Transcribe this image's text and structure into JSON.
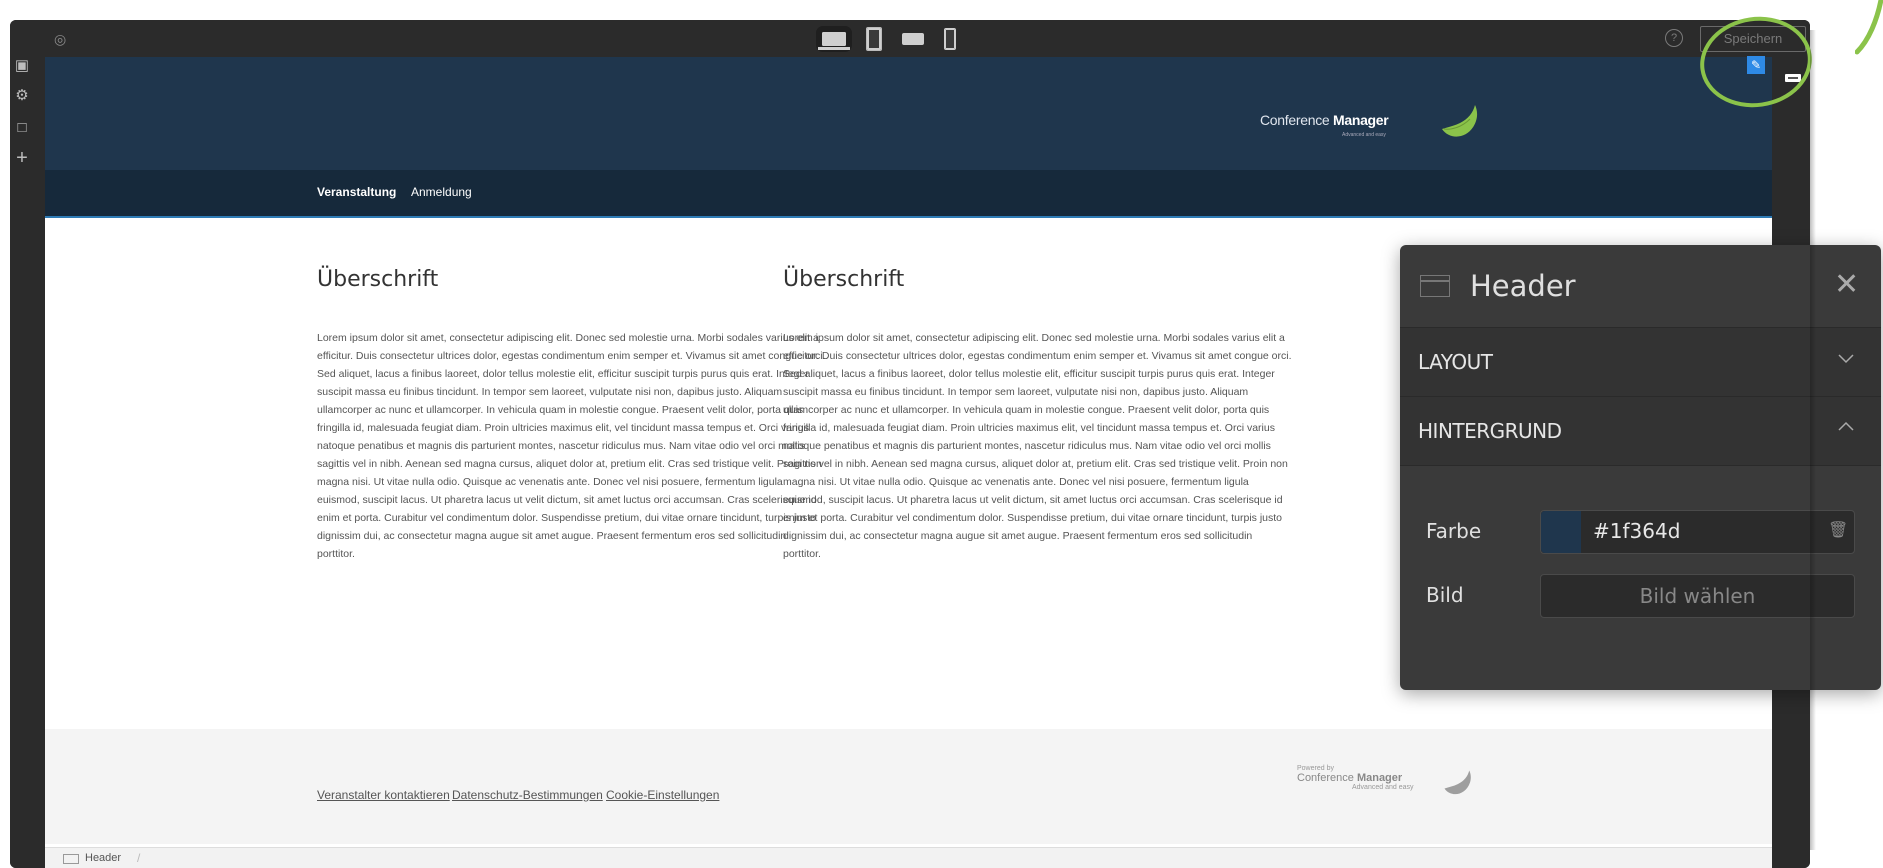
{
  "toolbar": {
    "device_icons": [
      "desktop-icon",
      "tablet-portrait-icon",
      "tablet-landscape-icon",
      "phone-icon"
    ],
    "save_label": "Speichern"
  },
  "site": {
    "nav": [
      "Veranstaltung",
      "Anmeldung"
    ],
    "logo": {
      "prefix": "Conference ",
      "name": "Manager",
      "tagline": "Advanced and easy"
    },
    "columns": [
      {
        "heading": "Überschrift",
        "text": "Lorem ipsum dolor sit amet, consectetur adipiscing elit. Donec sed molestie urna. Morbi sodales varius elit a efficitur. Duis consectetur ultrices dolor, egestas condimentum enim semper et. Vivamus sit amet congue orci. Sed aliquet, lacus a finibus laoreet, dolor tellus molestie elit, efficitur suscipit turpis purus quis erat. Integer suscipit massa eu finibus tincidunt. In tempor sem laoreet, vulputate nisi non, dapibus justo. Aliquam ullamcorper ac nunc et ullamcorper. In vehicula quam in molestie congue. Praesent velit dolor, porta quis fringilla id, malesuada feugiat diam. Proin ultricies maximus elit, vel tincidunt massa tempus et. Orci varius natoque penatibus et magnis dis parturient montes, nascetur ridiculus mus. Nam vitae odio vel orci mollis sagittis vel in nibh. Aenean sed magna cursus, aliquet dolor at, pretium elit. Cras sed tristique velit. Proin non magna nisi. Ut vitae nulla odio. Quisque ac venenatis ante. Donec vel nisi posuere, fermentum ligula euismod, suscipit lacus. Ut pharetra lacus ut velit dictum, sit amet luctus orci accumsan. Cras scelerisque id enim et porta. Curabitur vel condimentum dolor. Suspendisse pretium, dui vitae ornare tincidunt, turpis justo dignissim dui, ac consectetur magna augue sit amet augue. Praesent fermentum eros sed sollicitudin porttitor."
      },
      {
        "heading": "Überschrift",
        "text": "Lorem ipsum dolor sit amet, consectetur adipiscing elit. Donec sed molestie urna. Morbi sodales varius elit a efficitur. Duis consectetur ultrices dolor, egestas condimentum enim semper et. Vivamus sit amet congue orci. Sed aliquet, lacus a finibus laoreet, dolor tellus molestie elit, efficitur suscipit turpis purus quis erat. Integer suscipit massa eu finibus tincidunt. In tempor sem laoreet, vulputate nisi non, dapibus justo. Aliquam ullamcorper ac nunc et ullamcorper. In vehicula quam in molestie congue. Praesent velit dolor, porta quis fringilla id, malesuada feugiat diam. Proin ultricies maximus elit, vel tincidunt massa tempus et. Orci varius natoque penatibus et magnis dis parturient montes, nascetur ridiculus mus. Nam vitae odio vel orci mollis sagittis vel in nibh. Aenean sed magna cursus, aliquet dolor at, pretium elit. Cras sed tristique velit. Proin non magna nisi. Ut vitae nulla odio. Quisque ac venenatis ante. Donec vel nisi posuere, fermentum ligula euismod, suscipit lacus. Ut pharetra lacus ut velit dictum, sit amet luctus orci accumsan. Cras scelerisque id enim et porta. Curabitur vel condimentum dolor. Suspendisse pretium, dui vitae ornare tincidunt, turpis justo dignissim dui, ac consectetur magna augue sit amet augue. Praesent fermentum eros sed sollicitudin porttitor."
      }
    ],
    "footer": {
      "links": [
        "Veranstalter kontaktieren",
        "Datenschutz-Bestimmungen",
        "Cookie-Einstellungen"
      ],
      "powered_by": "Powered by",
      "brand_prefix": "Conference ",
      "brand_name": "Manager",
      "tagline": "Advanced and easy"
    },
    "header_color": "#1f364d"
  },
  "breadcrumb": {
    "current": "Header",
    "separator": "/"
  },
  "panel": {
    "title": "Header",
    "sections": [
      {
        "label": "LAYOUT",
        "expanded": false
      },
      {
        "label": "HINTERGRUND",
        "expanded": true
      }
    ],
    "color_label": "Farbe",
    "color_value": "#1f364d",
    "image_label": "Bild",
    "image_button": "Bild wählen"
  },
  "colors": {
    "accent_green": "#8bc34a",
    "nav_bar": "#16293b",
    "highlight_blue": "#2e8ae6"
  }
}
